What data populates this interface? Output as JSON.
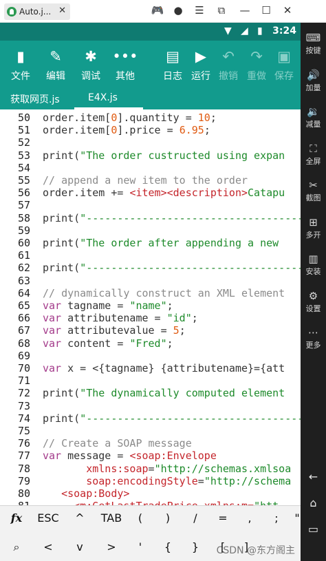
{
  "window": {
    "tab_title": "Auto.j...",
    "tab_close": "✕",
    "controls": [
      "🎮",
      "●",
      "☰",
      "⧉",
      "—",
      "☐",
      "✕"
    ]
  },
  "statusbar": {
    "time": "3:24"
  },
  "toolbar": {
    "buttons": [
      {
        "label": "文件",
        "icon": "file-icon",
        "glyph": "▮"
      },
      {
        "label": "编辑",
        "icon": "pencil-icon",
        "glyph": "✎"
      },
      {
        "label": "调试",
        "icon": "bug-icon",
        "glyph": "✱"
      },
      {
        "label": "其他",
        "icon": "more-icon",
        "glyph": "•••"
      },
      {
        "label": "日志",
        "icon": "log-icon",
        "glyph": "▤"
      },
      {
        "label": "运行",
        "icon": "play-icon",
        "glyph": "▶"
      },
      {
        "label": "撤销",
        "icon": "undo-icon",
        "glyph": "↶"
      },
      {
        "label": "重做",
        "icon": "redo-icon",
        "glyph": "↷"
      },
      {
        "label": "保存",
        "icon": "save-icon",
        "glyph": "▣"
      }
    ]
  },
  "tabs": [
    {
      "label": "获取网页.js"
    },
    {
      "label": "E4X.js"
    }
  ],
  "code": {
    "lines": [
      {
        "n": "50",
        "segs": [
          [
            "",
            "order.item["
          ],
          [
            "num",
            "0"
          ],
          [
            "",
            "].quantity = "
          ],
          [
            "num",
            "10"
          ],
          [
            "",
            ";"
          ]
        ]
      },
      {
        "n": "51",
        "segs": [
          [
            "",
            "order.item["
          ],
          [
            "num",
            "0"
          ],
          [
            "",
            "].price = "
          ],
          [
            "num",
            "6.95"
          ],
          [
            "",
            ";"
          ]
        ]
      },
      {
        "n": "52",
        "segs": []
      },
      {
        "n": "53",
        "segs": [
          [
            "",
            "print("
          ],
          [
            "str",
            "\"The order custructed using expan"
          ]
        ]
      },
      {
        "n": "54",
        "segs": []
      },
      {
        "n": "55",
        "segs": [
          [
            "cmt",
            "// append a new item to the order"
          ]
        ]
      },
      {
        "n": "56",
        "segs": [
          [
            "",
            "order.item += "
          ],
          [
            "tag",
            "<item><description>"
          ],
          [
            "str",
            "Catapu"
          ]
        ]
      },
      {
        "n": "57",
        "segs": []
      },
      {
        "n": "58",
        "segs": [
          [
            "",
            "print("
          ],
          [
            "str",
            "\"-----------------------------------"
          ]
        ]
      },
      {
        "n": "59",
        "segs": []
      },
      {
        "n": "60",
        "segs": [
          [
            "",
            "print("
          ],
          [
            "str",
            "\"The order after appending a new"
          ]
        ]
      },
      {
        "n": "61",
        "segs": []
      },
      {
        "n": "62",
        "segs": [
          [
            "",
            "print("
          ],
          [
            "str",
            "\"-----------------------------------"
          ]
        ]
      },
      {
        "n": "63",
        "segs": []
      },
      {
        "n": "64",
        "segs": [
          [
            "cmt",
            "// dynamically construct an XML element"
          ]
        ]
      },
      {
        "n": "65",
        "segs": [
          [
            "kw",
            "var"
          ],
          [
            "",
            " tagname = "
          ],
          [
            "str",
            "\"name\""
          ],
          [
            "",
            ";"
          ]
        ]
      },
      {
        "n": "66",
        "segs": [
          [
            "kw",
            "var"
          ],
          [
            "",
            " attributename = "
          ],
          [
            "str",
            "\"id\""
          ],
          [
            "",
            ";"
          ]
        ]
      },
      {
        "n": "67",
        "segs": [
          [
            "kw",
            "var"
          ],
          [
            "",
            " attributevalue = "
          ],
          [
            "num",
            "5"
          ],
          [
            "",
            ";"
          ]
        ]
      },
      {
        "n": "68",
        "segs": [
          [
            "kw",
            "var"
          ],
          [
            "",
            " content = "
          ],
          [
            "str",
            "\"Fred\""
          ],
          [
            "",
            ";"
          ]
        ]
      },
      {
        "n": "69",
        "segs": []
      },
      {
        "n": "70",
        "segs": [
          [
            "kw",
            "var"
          ],
          [
            "",
            " x = <{tagname} {attributename}={att"
          ]
        ]
      },
      {
        "n": "71",
        "segs": []
      },
      {
        "n": "72",
        "segs": [
          [
            "",
            "print("
          ],
          [
            "str",
            "\"The dynamically computed element"
          ]
        ]
      },
      {
        "n": "73",
        "segs": []
      },
      {
        "n": "74",
        "segs": [
          [
            "",
            "print("
          ],
          [
            "str",
            "\"-----------------------------------"
          ]
        ]
      },
      {
        "n": "75",
        "segs": []
      },
      {
        "n": "76",
        "segs": [
          [
            "cmt",
            "// Create a SOAP message"
          ]
        ]
      },
      {
        "n": "77",
        "segs": [
          [
            "kw",
            "var"
          ],
          [
            "",
            " message = "
          ],
          [
            "tag",
            "<soap:Envelope"
          ]
        ]
      },
      {
        "n": "78",
        "segs": [
          [
            "",
            "       "
          ],
          [
            "tag",
            "xmlns:soap"
          ],
          [
            "",
            "="
          ],
          [
            "str",
            "\"http://schemas.xmlsoa"
          ]
        ]
      },
      {
        "n": "79",
        "segs": [
          [
            "",
            "       "
          ],
          [
            "tag",
            "soap:encodingStyle"
          ],
          [
            "",
            "="
          ],
          [
            "str",
            "\"http://schema"
          ]
        ]
      },
      {
        "n": "80",
        "segs": [
          [
            "",
            "   "
          ],
          [
            "tag",
            "<soap:Body>"
          ]
        ]
      },
      {
        "n": "81",
        "segs": [
          [
            "",
            "     "
          ],
          [
            "tag",
            "<m:GetLastTradePrice xmlns:m="
          ],
          [
            "str",
            "\"htt"
          ]
        ]
      }
    ]
  },
  "symbols": {
    "row1": [
      "fx",
      "ESC",
      "^",
      "TAB",
      "(",
      ")",
      "/",
      "=",
      ",",
      ";",
      "\""
    ],
    "row2": [
      "⌕",
      "<",
      "v",
      ">",
      "'",
      "{",
      "}",
      "[",
      "]"
    ]
  },
  "watermark": "CSDN @东方阁主",
  "sidebar": [
    {
      "label": "按键",
      "icon": "keyboard-icon",
      "glyph": "⌨"
    },
    {
      "label": "加量",
      "icon": "volume-up-icon",
      "glyph": "🔊"
    },
    {
      "label": "减量",
      "icon": "volume-down-icon",
      "glyph": "🔉"
    },
    {
      "label": "全屏",
      "icon": "fullscreen-icon",
      "glyph": "⛶"
    },
    {
      "label": "截图",
      "icon": "scissors-icon",
      "glyph": "✂"
    },
    {
      "label": "多开",
      "icon": "multi-open-icon",
      "glyph": "⊞"
    },
    {
      "label": "安装",
      "icon": "apk-icon",
      "glyph": "▥"
    },
    {
      "label": "设置",
      "icon": "settings-icon",
      "glyph": "⚙"
    },
    {
      "label": "更多",
      "icon": "more-icon",
      "glyph": "⋯"
    }
  ],
  "sidebar_nav": [
    "←",
    "⌂",
    "▭"
  ]
}
